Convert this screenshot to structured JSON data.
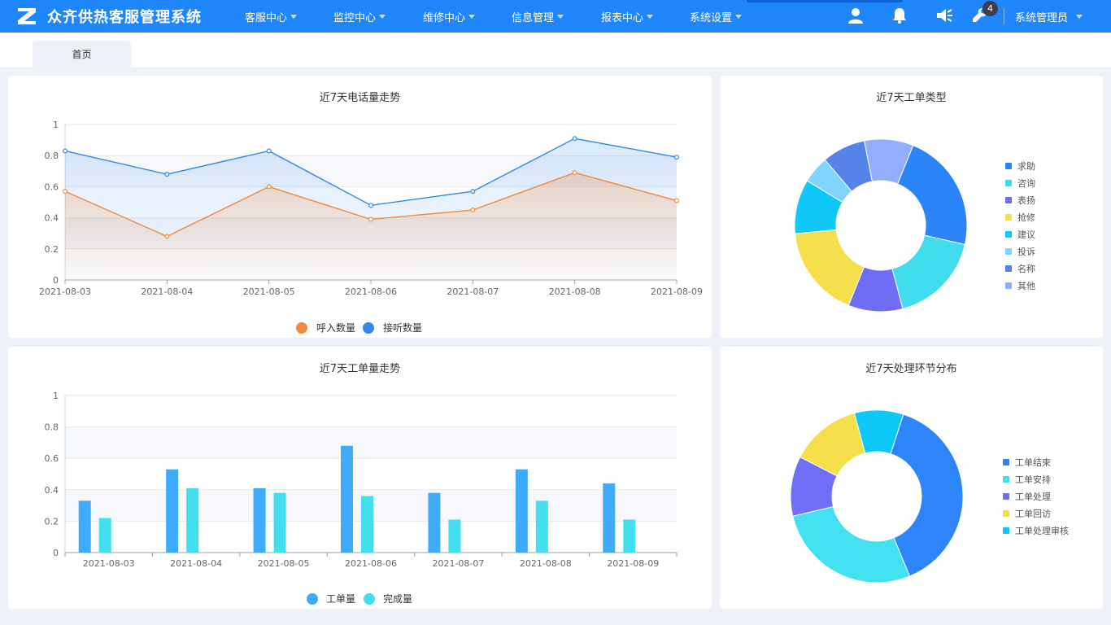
{
  "header": {
    "app_title": "众齐供热客服管理系统",
    "menu": [
      {
        "label": "客服中心"
      },
      {
        "label": "监控中心"
      },
      {
        "label": "维修中心"
      },
      {
        "label": "信息管理"
      },
      {
        "label": "报表中心"
      },
      {
        "label": "系统设置"
      }
    ],
    "icons": [
      "user-icon",
      "bell-icon",
      "speaker-icon",
      "wrench-icon"
    ],
    "badge_count": "4",
    "user_label": "系统管理员",
    "bg_color": "#1f86fb"
  },
  "tabs": [
    {
      "label": "首页"
    }
  ],
  "panels": {
    "call_trend": {
      "title": "近7天电话量走势",
      "chart_data": {
        "type": "line",
        "categories": [
          "2021-08-03",
          "2021-08-04",
          "2021-08-05",
          "2021-08-06",
          "2021-08-07",
          "2021-08-08",
          "2021-08-09"
        ],
        "series": [
          {
            "name": "呼入数量",
            "color": "#f08a3e",
            "values": [
              0.57,
              0.28,
              0.6,
              0.39,
              0.45,
              0.69,
              0.51
            ]
          },
          {
            "name": "接听数量",
            "color": "#2f89e6",
            "values": [
              0.83,
              0.68,
              0.83,
              0.48,
              0.57,
              0.91,
              0.79
            ]
          }
        ],
        "ylim": [
          0,
          1
        ],
        "yticks": [
          "0",
          "0.2",
          "0.4",
          "0.6",
          "0.8",
          "1"
        ],
        "grid": true,
        "legend": "bottom"
      }
    },
    "order_type": {
      "title": "近7天工单类型",
      "chart_data": {
        "type": "pie",
        "donut": true,
        "legend": "right",
        "slices": [
          {
            "label": "求助",
            "value": 22,
            "color": "#2b84f8"
          },
          {
            "label": "咨询",
            "value": 17,
            "color": "#41dcf0"
          },
          {
            "label": "表扬",
            "value": 10,
            "color": "#6f6cf6"
          },
          {
            "label": "抢修",
            "value": 17,
            "color": "#f5df4d"
          },
          {
            "label": "建议",
            "value": 10,
            "color": "#0fc8f8"
          },
          {
            "label": "投诉",
            "value": 5,
            "color": "#7fd5ff"
          },
          {
            "label": "名称",
            "value": 8,
            "color": "#5583e8"
          },
          {
            "label": "其他",
            "value": 9,
            "color": "#93aefc"
          }
        ]
      }
    },
    "order_trend": {
      "title": "近7天工单量走势",
      "chart_data": {
        "type": "bar",
        "categories": [
          "2021-08-03",
          "2021-08-04",
          "2021-08-05",
          "2021-08-06",
          "2021-08-07",
          "2021-08-08",
          "2021-08-09"
        ],
        "series": [
          {
            "name": "工单量",
            "color": "#3facfb",
            "values": [
              0.33,
              0.53,
              0.41,
              0.68,
              0.38,
              0.53,
              0.44
            ]
          },
          {
            "name": "完成量",
            "color": "#43dfee",
            "values": [
              0.22,
              0.41,
              0.38,
              0.36,
              0.21,
              0.33,
              0.21
            ]
          }
        ],
        "ylim": [
          0,
          1
        ],
        "yticks": [
          "0",
          "0.2",
          "0.4",
          "0.6",
          "0.8",
          "1"
        ],
        "grid": true,
        "legend": "bottom"
      }
    },
    "process_dist": {
      "title": "近7天处理环节分布",
      "chart_data": {
        "type": "pie",
        "donut": true,
        "legend": "right",
        "slices": [
          {
            "label": "工单结束",
            "value": 38,
            "color": "#2d85f9"
          },
          {
            "label": "工单安排",
            "value": 27,
            "color": "#43e0f0"
          },
          {
            "label": "工单处理",
            "value": 11,
            "color": "#716ef7"
          },
          {
            "label": "工单回访",
            "value": 13,
            "color": "#f5e04c"
          },
          {
            "label": "工单处理审核",
            "value": 9,
            "color": "#0ec9f8"
          }
        ]
      }
    }
  }
}
